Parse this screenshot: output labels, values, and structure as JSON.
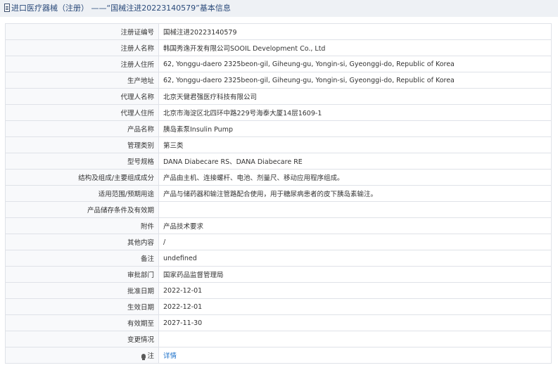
{
  "header": {
    "title": "进口医疗器械（注册） ——“国械注进20223140579”基本信息"
  },
  "rows": [
    {
      "label": "注册证编号",
      "value": "国械注进20223140579"
    },
    {
      "label": "注册人名称",
      "value": "韩国秀逸开发有限公司SOOIL Development Co., Ltd"
    },
    {
      "label": "注册人住所",
      "value": "62, Yonggu-daero 2325beon-gil, Giheung-gu, Yongin-si, Gyeonggi-do, Republic of Korea"
    },
    {
      "label": "生产地址",
      "value": "62, Yonggu-daero 2325beon-gil, Giheung-gu, Yongin-si, Gyeonggi-do, Republic of Korea"
    },
    {
      "label": "代理人名称",
      "value": "北京天健君强医疗科技有限公司"
    },
    {
      "label": "代理人住所",
      "value": "北京市海淀区北四环中路229号海泰大厦14层1609-1"
    },
    {
      "label": "产品名称",
      "value": "胰岛素泵Insulin Pump"
    },
    {
      "label": "管理类别",
      "value": "第三类"
    },
    {
      "label": "型号规格",
      "value": "DANA Diabecare RS、DANA Diabecare RE"
    },
    {
      "label": "结构及组成/主要组成成分",
      "value": "产品由主机、连接螺杆、电池、剂量尺、移动应用程序组成。"
    },
    {
      "label": "适用范围/预期用途",
      "value": "产品与储药器和输注管路配合使用，用于糖尿病患者的皮下胰岛素输注。"
    },
    {
      "label": "产品储存条件及有效期",
      "value": ""
    },
    {
      "label": "附件",
      "value": "产品技术要求"
    },
    {
      "label": "其他内容",
      "value": "/"
    },
    {
      "label": "备注",
      "value": "undefined"
    },
    {
      "label": "审批部门",
      "value": "国家药品监督管理局"
    },
    {
      "label": "批准日期",
      "value": "2022-12-01"
    },
    {
      "label": "生效日期",
      "value": "2022-12-01"
    },
    {
      "label": "有效期至",
      "value": "2027-11-30"
    },
    {
      "label": "变更情况",
      "value": ""
    }
  ],
  "note_row": {
    "label": "注",
    "icon": "lightbulb-icon",
    "link": "详情"
  }
}
